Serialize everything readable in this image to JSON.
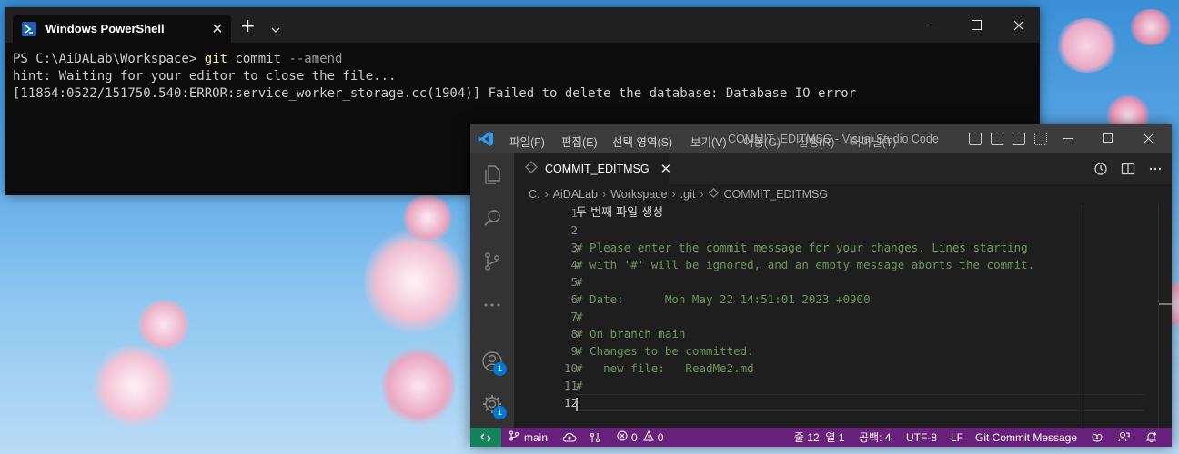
{
  "colors": {
    "terminal_bg": "#0c0c0c",
    "vscode_status_bar": "#68217a",
    "vscode_remote": "#16825d",
    "comment": "#6a9955",
    "badge": "#0078d4"
  },
  "terminal": {
    "tab_title": "Windows PowerShell",
    "prompt": "PS C:\\AiDALab\\Workspace> ",
    "cmd": "git",
    "args": " commit ",
    "flag": "--amend",
    "line2": "hint: Waiting for your editor to close the file...",
    "line3": "[11864:0522/151750.540:ERROR:service_worker_storage.cc(1904)] Failed to delete the database: Database IO error"
  },
  "vscode": {
    "menu": [
      "파일(F)",
      "편집(E)",
      "선택 영역(S)",
      "보기(V)",
      "이동(G)",
      "실행(R)",
      "터미널(T)"
    ],
    "window_title": "COMMIT_EDITMSG - Visual Studio Code",
    "tab": {
      "label": "COMMIT_EDITMSG"
    },
    "breadcrumb": [
      "C:",
      "AiDALab",
      "Workspace",
      ".git",
      "COMMIT_EDITMSG"
    ],
    "activity_badges": {
      "accounts": "1",
      "manage": "1"
    },
    "lines": [
      "두 번째 파일 생성",
      "",
      "# Please enter the commit message for your changes. Lines starting",
      "# with '#' will be ignored, and an empty message aborts the commit.",
      "#",
      "# Date:      Mon May 22 14:51:01 2023 +0900",
      "#",
      "# On branch main",
      "# Changes to be committed:",
      "#\tnew file:   ReadMe2.md",
      "#",
      ""
    ],
    "line_numbers": [
      "1",
      "2",
      "3",
      "4",
      "5",
      "6",
      "7",
      "8",
      "9",
      "10",
      "11",
      "12"
    ],
    "status": {
      "branch": "main",
      "errors": "0",
      "warnings": "0",
      "position": "줄 12, 열 1",
      "spaces": "공백: 4",
      "encoding": "UTF-8",
      "eol": "LF",
      "language": "Git Commit Message"
    }
  }
}
